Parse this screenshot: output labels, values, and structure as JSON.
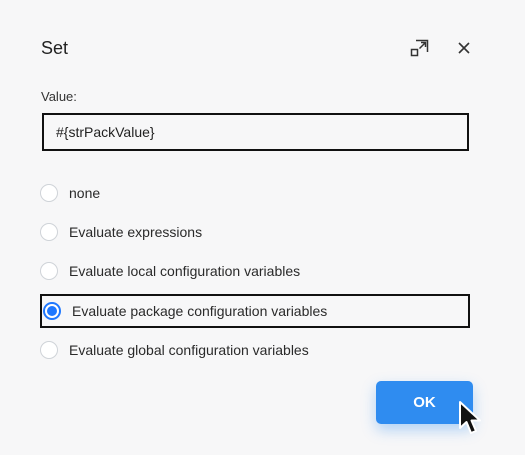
{
  "dialog": {
    "title": "Set",
    "icons": {
      "expand": "expand-icon",
      "close": "close-icon"
    }
  },
  "value_field": {
    "label": "Value:",
    "value": "#{strPackValue}"
  },
  "options": [
    {
      "label": "none",
      "selected": false
    },
    {
      "label": "Evaluate expressions",
      "selected": false
    },
    {
      "label": "Evaluate local configuration variables",
      "selected": false
    },
    {
      "label": "Evaluate package configuration variables",
      "selected": true
    },
    {
      "label": "Evaluate global configuration variables",
      "selected": false
    }
  ],
  "ok_button": {
    "label": "OK"
  },
  "colors": {
    "accent": "#2f8cf0",
    "radio_selected": "#1f78ff",
    "highlight_border": "#111111"
  }
}
